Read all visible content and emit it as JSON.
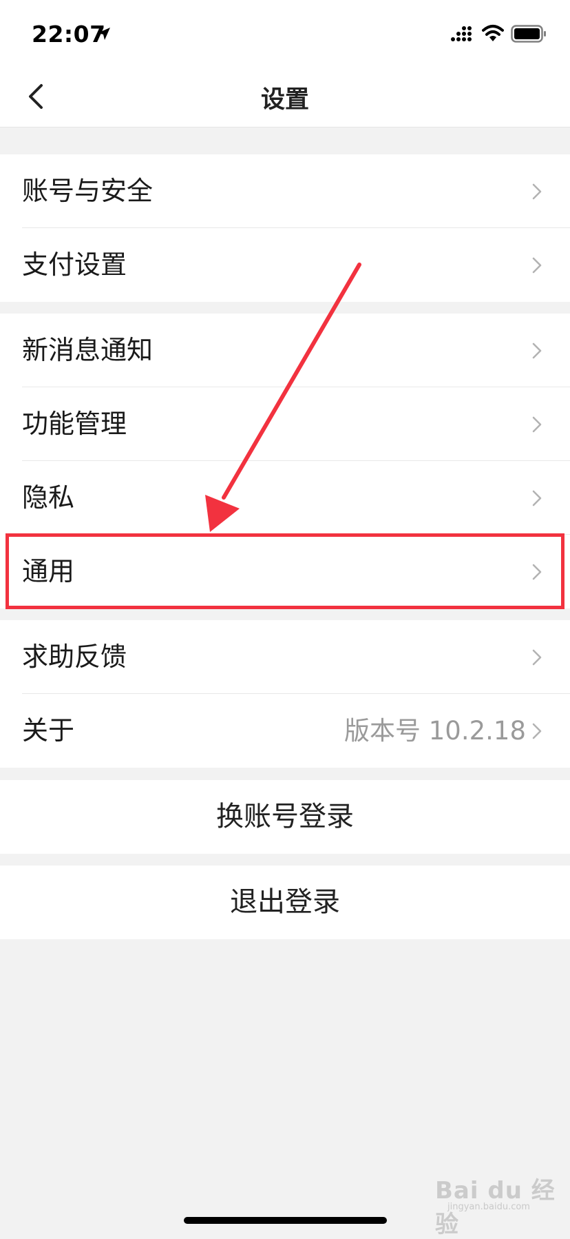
{
  "status_bar": {
    "time": "22:07",
    "icons": [
      "location-arrow-icon",
      "signal-icon",
      "wifi-icon",
      "battery-icon"
    ]
  },
  "nav": {
    "title": "设置",
    "back_icon": "chevron-left-icon"
  },
  "groups": [
    {
      "items": [
        {
          "label": "账号与安全"
        },
        {
          "label": "支付设置"
        }
      ]
    },
    {
      "items": [
        {
          "label": "新消息通知"
        },
        {
          "label": "功能管理"
        },
        {
          "label": "隐私"
        },
        {
          "label": "通用"
        }
      ]
    },
    {
      "items": [
        {
          "label": "求助反馈"
        },
        {
          "label": "关于",
          "value": "版本号 10.2.18"
        }
      ]
    }
  ],
  "buttons": {
    "switch_account": "换账号登录",
    "logout": "退出登录"
  },
  "annotation": {
    "highlighted_item": "通用",
    "color": "#f2323f"
  },
  "watermark": {
    "brand": "Bai du 经验",
    "url": "jingyan.baidu.com"
  },
  "colors": {
    "background": "#f2f2f2",
    "surface": "#ffffff",
    "secondary_text": "#9a9a9a",
    "annotation": "#f2323f"
  }
}
